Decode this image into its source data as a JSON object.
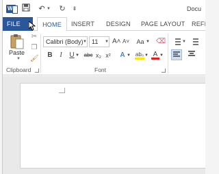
{
  "titlebar": {
    "app_icon": "word-icon",
    "app_icon_letter": "W",
    "doc_title": "Docu",
    "qat": {
      "save_icon": "save-icon",
      "undo_icon": "undo-icon",
      "redo_icon": "redo-icon",
      "customize_icon": "customize-qat-icon"
    }
  },
  "tabs": [
    {
      "label": "FILE"
    },
    {
      "label": "HOME",
      "active": true
    },
    {
      "label": "INSERT"
    },
    {
      "label": "DESIGN"
    },
    {
      "label": "PAGE LAYOUT"
    },
    {
      "label": "REFI"
    }
  ],
  "ribbon": {
    "clipboard": {
      "paste_label": "Paste",
      "group_label": "Clipboard"
    },
    "font": {
      "font_name": "Calibri (Body)",
      "font_size": "11",
      "grow_label": "A˄",
      "shrink_label": "A˅",
      "case_label": "Aa",
      "bold_label": "B",
      "italic_label": "I",
      "underline_label": "U",
      "strike_label": "abc",
      "sub_label": "x₂",
      "sup_label": "x²",
      "effects_label": "A",
      "highlight_label": "ab₀",
      "color_label": "A",
      "group_label": "Font"
    }
  },
  "colors": {
    "accent": "#2b579a",
    "highlight": "#ffe600",
    "font_color": "#e02020"
  }
}
